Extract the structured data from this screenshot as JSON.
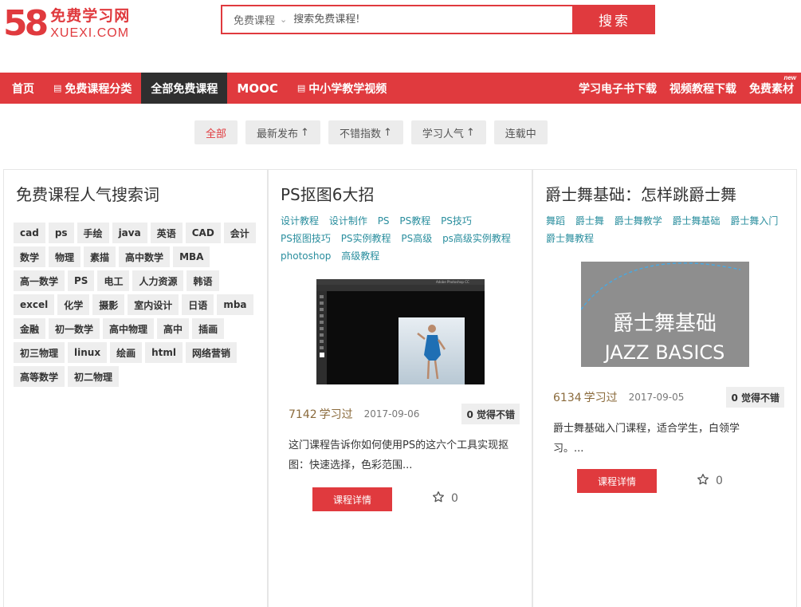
{
  "brand": {
    "logo_number": "58",
    "logo_cn": "免费学习网",
    "logo_en": "XUEXI.COM",
    "accent_color": "#e03a3e"
  },
  "search": {
    "category": "免费课程",
    "placeholder": "搜索免费课程!",
    "button_label": "搜索"
  },
  "nav": {
    "left": [
      {
        "label": "首页"
      },
      {
        "label": "免费课程分类",
        "icon": "menu-icon"
      },
      {
        "label": "全部免费课程",
        "active": true
      },
      {
        "label": "MOOC"
      },
      {
        "label": "中小学教学视频",
        "icon": "menu-icon"
      }
    ],
    "right": [
      {
        "label": "学习电子书下载"
      },
      {
        "label": "视频教程下载"
      },
      {
        "label": "免费素材",
        "badge": "new"
      }
    ]
  },
  "filters": [
    {
      "label": "全部",
      "active": true
    },
    {
      "label": "最新发布",
      "sort": true
    },
    {
      "label": "不错指数",
      "sort": true
    },
    {
      "label": "学习人气",
      "sort": true
    },
    {
      "label": "连载中"
    }
  ],
  "popular": {
    "title": "免费课程人气搜索词",
    "tags": [
      "cad",
      "ps",
      "手绘",
      "java",
      "英语",
      "CAD",
      "会计",
      "数学",
      "物理",
      "素描",
      "高中数学",
      "MBA",
      "高一数学",
      "PS",
      "电工",
      "人力资源",
      "韩语",
      "excel",
      "化学",
      "摄影",
      "室内设计",
      "日语",
      "mba",
      "金融",
      "初一数学",
      "高中物理",
      "高中",
      "插画",
      "初三物理",
      "linux",
      "绘画",
      "html",
      "网络营销",
      "高等数学",
      "初二物理"
    ]
  },
  "courses": [
    {
      "title": "PS抠图6大招",
      "keywords": [
        "设计教程",
        "设计制作",
        "PS",
        "PS教程",
        "PS技巧",
        "PS抠图技巧",
        "PS实例教程",
        "PS高级",
        "ps高级实例教程",
        "photoshop",
        "高级教程"
      ],
      "learned_count": "7142",
      "learned_label": "学习过",
      "date": "2017-09-06",
      "vote_label": "0 觉得不错",
      "description": "这门课程告诉你如何使用PS的这六个工具实现抠图：快速选择，色彩范围...",
      "detail_label": "课程详情",
      "favorites": "0",
      "thumb_title": "Adobe Photoshop CC"
    },
    {
      "title": "爵士舞基础：怎样跳爵士舞",
      "keywords": [
        "舞蹈",
        "爵士舞",
        "爵士舞教学",
        "爵士舞基础",
        "爵士舞入门",
        "爵士舞教程"
      ],
      "learned_count": "6134",
      "learned_label": "学习过",
      "date": "2017-09-05",
      "vote_label": "0 觉得不错",
      "description": "爵士舞基础入门课程，适合学生，白领学习。...",
      "detail_label": "课程详情",
      "favorites": "0",
      "thumb_cn": "爵士舞基础",
      "thumb_en": "JAZZ BASICS"
    }
  ]
}
